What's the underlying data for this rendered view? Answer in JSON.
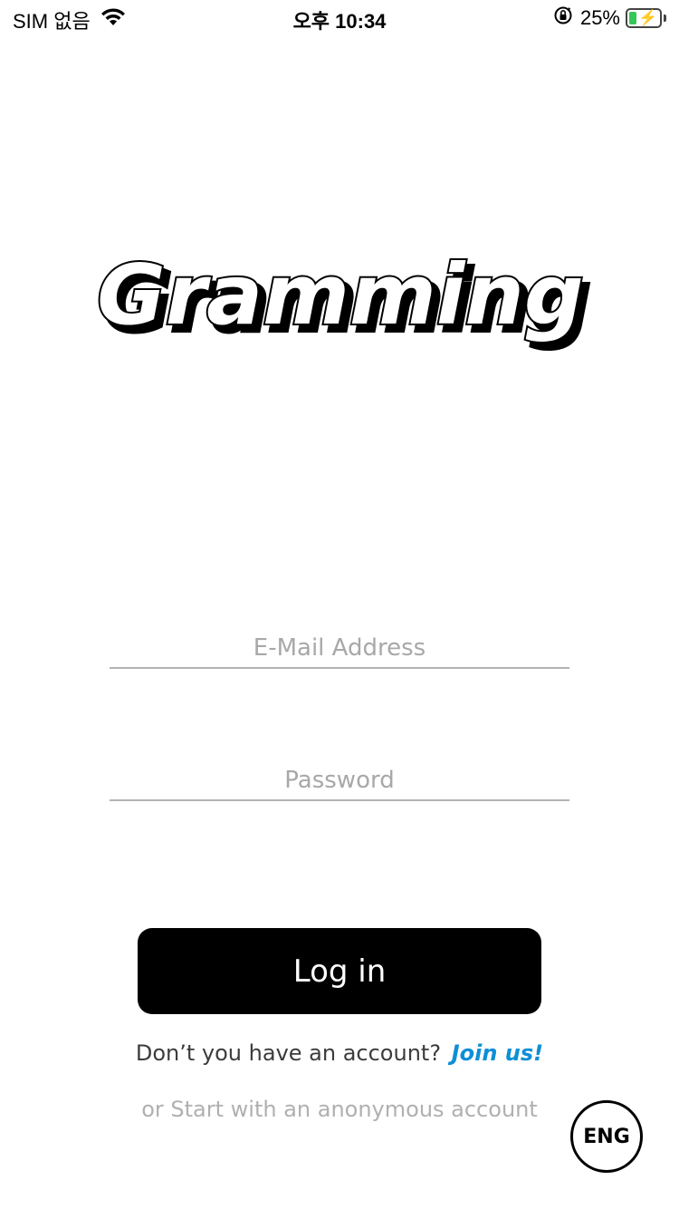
{
  "status_bar": {
    "carrier": "SIM 없음",
    "time": "오후 10:34",
    "battery_percent": "25%",
    "battery_level": 0.25,
    "icons": [
      "wifi-icon",
      "orientation-lock-icon",
      "battery-charging-icon"
    ]
  },
  "app": {
    "logo_text": "Gramming"
  },
  "form": {
    "email_placeholder": "E-Mail Address",
    "password_placeholder": "Password",
    "login_label": "Log in"
  },
  "signup": {
    "prompt": "Don’t you have an account?",
    "link": "Join us!"
  },
  "anonymous_link": "or Start with an anonymous account",
  "language_button": "ENG",
  "colors": {
    "accent_link": "#0e8fd6",
    "button_bg": "#000000",
    "placeholder": "#a8a8a8",
    "battery_fill": "#34c759"
  }
}
